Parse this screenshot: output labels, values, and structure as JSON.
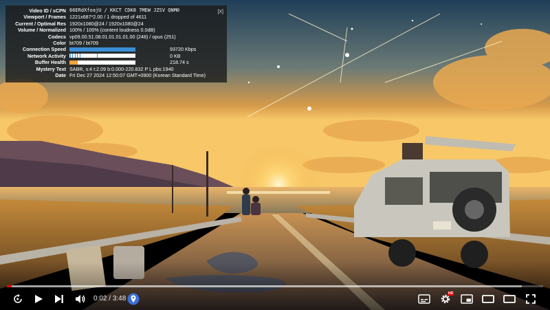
{
  "stats": {
    "close_label": "[X]",
    "rows": [
      {
        "label": "Video ID / sCPN",
        "value": "66ERdXfoajU / KKCT CDK8 7MEW JZSV QNM0",
        "mono": true
      },
      {
        "label": "Viewport / Frames",
        "value": "1221x687*2.00 / 1 dropped of 4611"
      },
      {
        "label": "Current / Optimal Res",
        "value": "1920x1080@24 / 1920x1080@24"
      },
      {
        "label": "Volume / Normalized",
        "value": "100% / 100% (content loudness 0.0dB)"
      },
      {
        "label": "Codecs",
        "value": "vp09.00.51.08.01.01.01.01.00 (248) / opus (251)"
      },
      {
        "label": "Color",
        "value": "bt709 / bt709"
      }
    ],
    "connection_speed": {
      "label": "Connection Speed",
      "value": "93720 Kbps"
    },
    "network_activity": {
      "label": "Network Activity",
      "value": "0 KB"
    },
    "buffer_health": {
      "label": "Buffer Health",
      "value": "218.74 s"
    },
    "mystery_text": {
      "label": "Mystery Text",
      "value": "SABR, s:4 t:2.09 b:0.000-220.832 P L pbs:1940"
    },
    "date": {
      "label": "Date",
      "value": "Fri Dec 27 2024 12:50:07 GMT+0900 (Korean Standard Time)"
    }
  },
  "player": {
    "current_time": "0:02",
    "duration": "3:48",
    "time_separator": "/",
    "played_fraction": 0.009,
    "buffered_fraction": 0.96,
    "hd_badge": "HD",
    "colors": {
      "progress_played": "#ff0000",
      "stats_bg": "#1c1c1ccc",
      "connection_bar": "#3a8fd8",
      "buffer_bar": "#f2a33a"
    }
  },
  "icons": [
    "autoplay-icon",
    "play-icon",
    "next-icon",
    "volume-icon",
    "location-pin-icon",
    "subtitles-icon",
    "settings-icon",
    "miniplayer-icon",
    "theater-icon",
    "cast-icon",
    "fullscreen-icon"
  ]
}
